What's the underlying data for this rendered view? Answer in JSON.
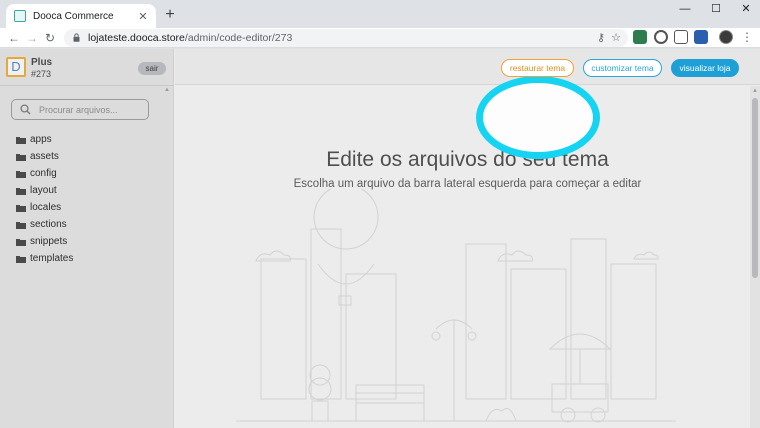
{
  "browser": {
    "tab_title": "Dooca Commerce",
    "url_host": "lojateste.dooca.store",
    "url_path": "/admin/code-editor/273"
  },
  "sidebar": {
    "brand_name": "Plus",
    "brand_id": "#273",
    "logout_label": "sair",
    "search_placeholder": "Procurar arquivos...",
    "folders": [
      "apps",
      "assets",
      "config",
      "layout",
      "locales",
      "sections",
      "snippets",
      "templates"
    ]
  },
  "topbar": {
    "restore_label": "restaurar tema",
    "customize_label": "customizar tema",
    "view_label": "visualizar loja"
  },
  "main": {
    "title": "Edite os arquivos do seu tema",
    "subtitle": "Escolha um arquivo da barra lateral esquerda para começar a editar"
  },
  "colors": {
    "highlight_ring": "#14d4f2",
    "restore_orange": "#f0a23a",
    "accent_blue": "#1ea0d6"
  }
}
